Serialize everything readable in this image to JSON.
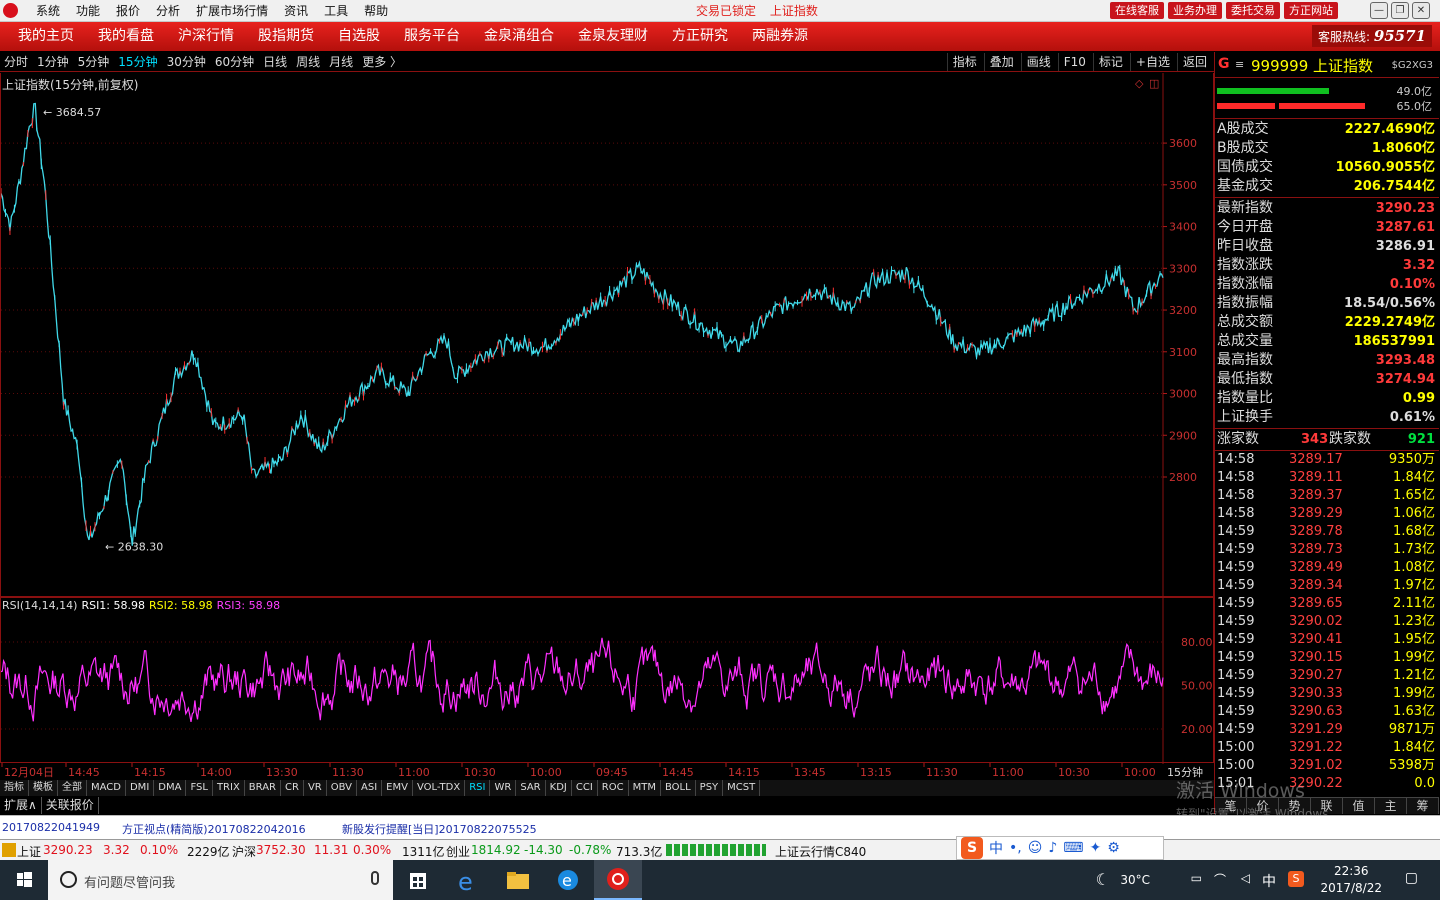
{
  "menu": [
    "系统",
    "功能",
    "报价",
    "分析",
    "扩展市场行情",
    "资讯",
    "工具",
    "帮助"
  ],
  "status_msgs": [
    "交易已锁定",
    "上证指数"
  ],
  "title_buttons": [
    "在线客服",
    "业务办理",
    "委托交易",
    "方正网站"
  ],
  "nav": [
    "我的主页",
    "我的看盘",
    "沪深行情",
    "股指期货",
    "自选股",
    "服务平台",
    "金泉涌组合",
    "金泉友理财",
    "方正研究",
    "两融券源"
  ],
  "hotline": {
    "label": "客服热线:",
    "number": "95571"
  },
  "periods": [
    "分时",
    "1分钟",
    "5分钟",
    "15分钟",
    "30分钟",
    "60分钟",
    "日线",
    "周线",
    "月线",
    "更多 〉"
  ],
  "active_period": "15分钟",
  "tools": [
    "指标",
    "叠加",
    "画线",
    "F10",
    "标记",
    "+自选",
    "返回"
  ],
  "chart_title": "上证指数(15分钟,前复权)",
  "rsi_legend": {
    "name": "RSI(14,14,14)",
    "rsi1": "RSI1: 58.98",
    "rsi2": "RSI2: 58.98",
    "rsi3": "RSI3: 58.98"
  },
  "indicator_tabs": [
    "指标",
    "模板",
    "全部",
    "MACD",
    "DMI",
    "DMA",
    "FSL",
    "TRIX",
    "BRAR",
    "CR",
    "VR",
    "OBV",
    "ASI",
    "EMV",
    "VOL-TDX",
    "RSI",
    "WR",
    "SAR",
    "KDJ",
    "CCI",
    "ROC",
    "MTM",
    "BOLL",
    "PSY",
    "MCST"
  ],
  "active_indicator": "RSI",
  "expand_tabs": [
    "扩展∧",
    "关联报价"
  ],
  "chart_data": {
    "type": "line",
    "title": "上证指数(15分钟,前复权)",
    "y_ticks": [
      3600,
      3500,
      3400,
      3300,
      3200,
      3100,
      3000,
      2900,
      2800
    ],
    "ylim": [
      2570,
      3720
    ],
    "price_high_label": "3684.57",
    "price_low_label": "2638.30",
    "x_ticks": [
      "12月04日",
      "14:45",
      "14:15",
      "14:00",
      "13:30",
      "11:30",
      "11:00",
      "10:30",
      "10:00",
      "09:45",
      "14:45",
      "14:15",
      "13:45",
      "13:15",
      "11:30",
      "11:00",
      "10:30",
      "10:00"
    ],
    "x_unit": "15分钟",
    "keypoints": [
      [
        0,
        3480
      ],
      [
        0.01,
        3400
      ],
      [
        0.02,
        3520
      ],
      [
        0.03,
        3650
      ],
      [
        0.035,
        3684
      ],
      [
        0.045,
        3500
      ],
      [
        0.055,
        3240
      ],
      [
        0.065,
        2980
      ],
      [
        0.08,
        2860
      ],
      [
        0.09,
        2638
      ],
      [
        0.11,
        2760
      ],
      [
        0.125,
        2850
      ],
      [
        0.135,
        2638
      ],
      [
        0.15,
        2820
      ],
      [
        0.18,
        3040
      ],
      [
        0.2,
        3100
      ],
      [
        0.22,
        2920
      ],
      [
        0.25,
        2950
      ],
      [
        0.26,
        2800
      ],
      [
        0.29,
        2840
      ],
      [
        0.31,
        2950
      ],
      [
        0.33,
        2860
      ],
      [
        0.36,
        2980
      ],
      [
        0.39,
        3050
      ],
      [
        0.42,
        3000
      ],
      [
        0.44,
        3090
      ],
      [
        0.46,
        3130
      ],
      [
        0.47,
        3040
      ],
      [
        0.5,
        3100
      ],
      [
        0.53,
        3120
      ],
      [
        0.56,
        3110
      ],
      [
        0.6,
        3190
      ],
      [
        0.63,
        3240
      ],
      [
        0.66,
        3300
      ],
      [
        0.68,
        3240
      ],
      [
        0.72,
        3170
      ],
      [
        0.76,
        3110
      ],
      [
        0.8,
        3200
      ],
      [
        0.84,
        3250
      ],
      [
        0.88,
        3200
      ],
      [
        0.9,
        3270
      ],
      [
        0.935,
        3290
      ],
      [
        0.96,
        3220
      ],
      [
        0.985,
        3120
      ],
      [
        1.01,
        3100
      ],
      [
        1.04,
        3130
      ],
      [
        1.08,
        3180
      ],
      [
        1.12,
        3240
      ],
      [
        1.155,
        3286
      ],
      [
        1.17,
        3200
      ],
      [
        1.2,
        3290
      ]
    ],
    "rsi_ticks": [
      80,
      50,
      20
    ]
  },
  "quote": {
    "code": "999999 上证指数",
    "tag": "$G2XG3",
    "bar_vals": [
      "49.0亿",
      "65.0亿"
    ],
    "turnover": [
      {
        "k": "A股成交",
        "v": "2227.4690亿"
      },
      {
        "k": "B股成交",
        "v": "1.8060亿"
      },
      {
        "k": "国债成交",
        "v": "10560.9055亿"
      },
      {
        "k": "基金成交",
        "v": "206.7544亿"
      }
    ],
    "stats": [
      {
        "k": "最新指数",
        "v": "3290.23",
        "c": "#ff3a3a"
      },
      {
        "k": "今日开盘",
        "v": "3287.61",
        "c": "#ff3a3a"
      },
      {
        "k": "昨日收盘",
        "v": "3286.91",
        "c": "#dddddd"
      },
      {
        "k": "指数涨跌",
        "v": "3.32",
        "c": "#ff3a3a"
      },
      {
        "k": "指数涨幅",
        "v": "0.10%",
        "c": "#ff3a3a"
      },
      {
        "k": "指数振幅",
        "v": "18.54/0.56%",
        "c": "#dddddd"
      },
      {
        "k": "总成交额",
        "v": "2229.2749亿",
        "c": "#ffff00"
      },
      {
        "k": "总成交量",
        "v": "186537991",
        "c": "#ffff00"
      },
      {
        "k": "最高指数",
        "v": "3293.48",
        "c": "#ff3a3a"
      },
      {
        "k": "最低指数",
        "v": "3274.94",
        "c": "#ff3a3a"
      },
      {
        "k": "指数量比",
        "v": "0.99",
        "c": "#ffff00"
      },
      {
        "k": "上证换手",
        "v": "0.61%",
        "c": "#dddddd"
      }
    ],
    "updown": {
      "up_label": "涨家数",
      "up": "343",
      "down_label": "跌家数",
      "down": "921"
    },
    "ticks": [
      {
        "t": "14:58",
        "p": "3289.17",
        "q": "9350万"
      },
      {
        "t": "14:58",
        "p": "3289.11",
        "q": "1.84亿"
      },
      {
        "t": "14:58",
        "p": "3289.37",
        "q": "1.65亿"
      },
      {
        "t": "14:58",
        "p": "3289.29",
        "q": "1.06亿"
      },
      {
        "t": "14:59",
        "p": "3289.78",
        "q": "1.68亿"
      },
      {
        "t": "14:59",
        "p": "3289.73",
        "q": "1.73亿"
      },
      {
        "t": "14:59",
        "p": "3289.49",
        "q": "1.08亿"
      },
      {
        "t": "14:59",
        "p": "3289.34",
        "q": "1.97亿"
      },
      {
        "t": "14:59",
        "p": "3289.65",
        "q": "2.11亿"
      },
      {
        "t": "14:59",
        "p": "3290.02",
        "q": "1.23亿"
      },
      {
        "t": "14:59",
        "p": "3290.41",
        "q": "1.95亿"
      },
      {
        "t": "14:59",
        "p": "3290.15",
        "q": "1.99亿"
      },
      {
        "t": "14:59",
        "p": "3290.27",
        "q": "1.21亿"
      },
      {
        "t": "14:59",
        "p": "3290.33",
        "q": "1.99亿"
      },
      {
        "t": "14:59",
        "p": "3290.63",
        "q": "1.63亿"
      },
      {
        "t": "14:59",
        "p": "3291.29",
        "q": "9871万"
      },
      {
        "t": "15:00",
        "p": "3291.22",
        "q": "1.84亿"
      },
      {
        "t": "15:00",
        "p": "3291.02",
        "q": "5398万"
      },
      {
        "t": "15:01",
        "p": "3290.22",
        "q": "0.0"
      }
    ],
    "bottom_tabs": [
      "笔",
      "价",
      "势",
      "联",
      "值",
      "主",
      "筹"
    ]
  },
  "watermark": {
    "line1": "激活 Windows",
    "line2": "转到\"设置\"以激活 Windows。"
  },
  "news": [
    "20170822041949",
    "方正视点(精简版)20170822042016",
    "新股发行提醒[当日]20170822075525"
  ],
  "statusbar": {
    "sh_label": "上证",
    "sh_val": "3290.23",
    "sh_chg": "3.32",
    "sh_pct": "0.10%",
    "sh_amt": "2229亿",
    "hs_label": "沪深",
    "hs_val": "3752.30",
    "hs_chg": "11.31",
    "hs_pct": "0.30%",
    "hs_amt": "1311亿",
    "cy_label": "创业",
    "cy_val": "1814.92",
    "cy_chg": "-14.30",
    "cy_pct": "-0.78%",
    "cy_amt": "713.3亿",
    "cloud": "上证云行情C840"
  },
  "ime": {
    "lang": "中"
  },
  "taskbar": {
    "search_placeholder": "有问题尽管问我",
    "temp": "30°C",
    "input": "中",
    "time": "22:36",
    "date": "2017/8/22"
  }
}
